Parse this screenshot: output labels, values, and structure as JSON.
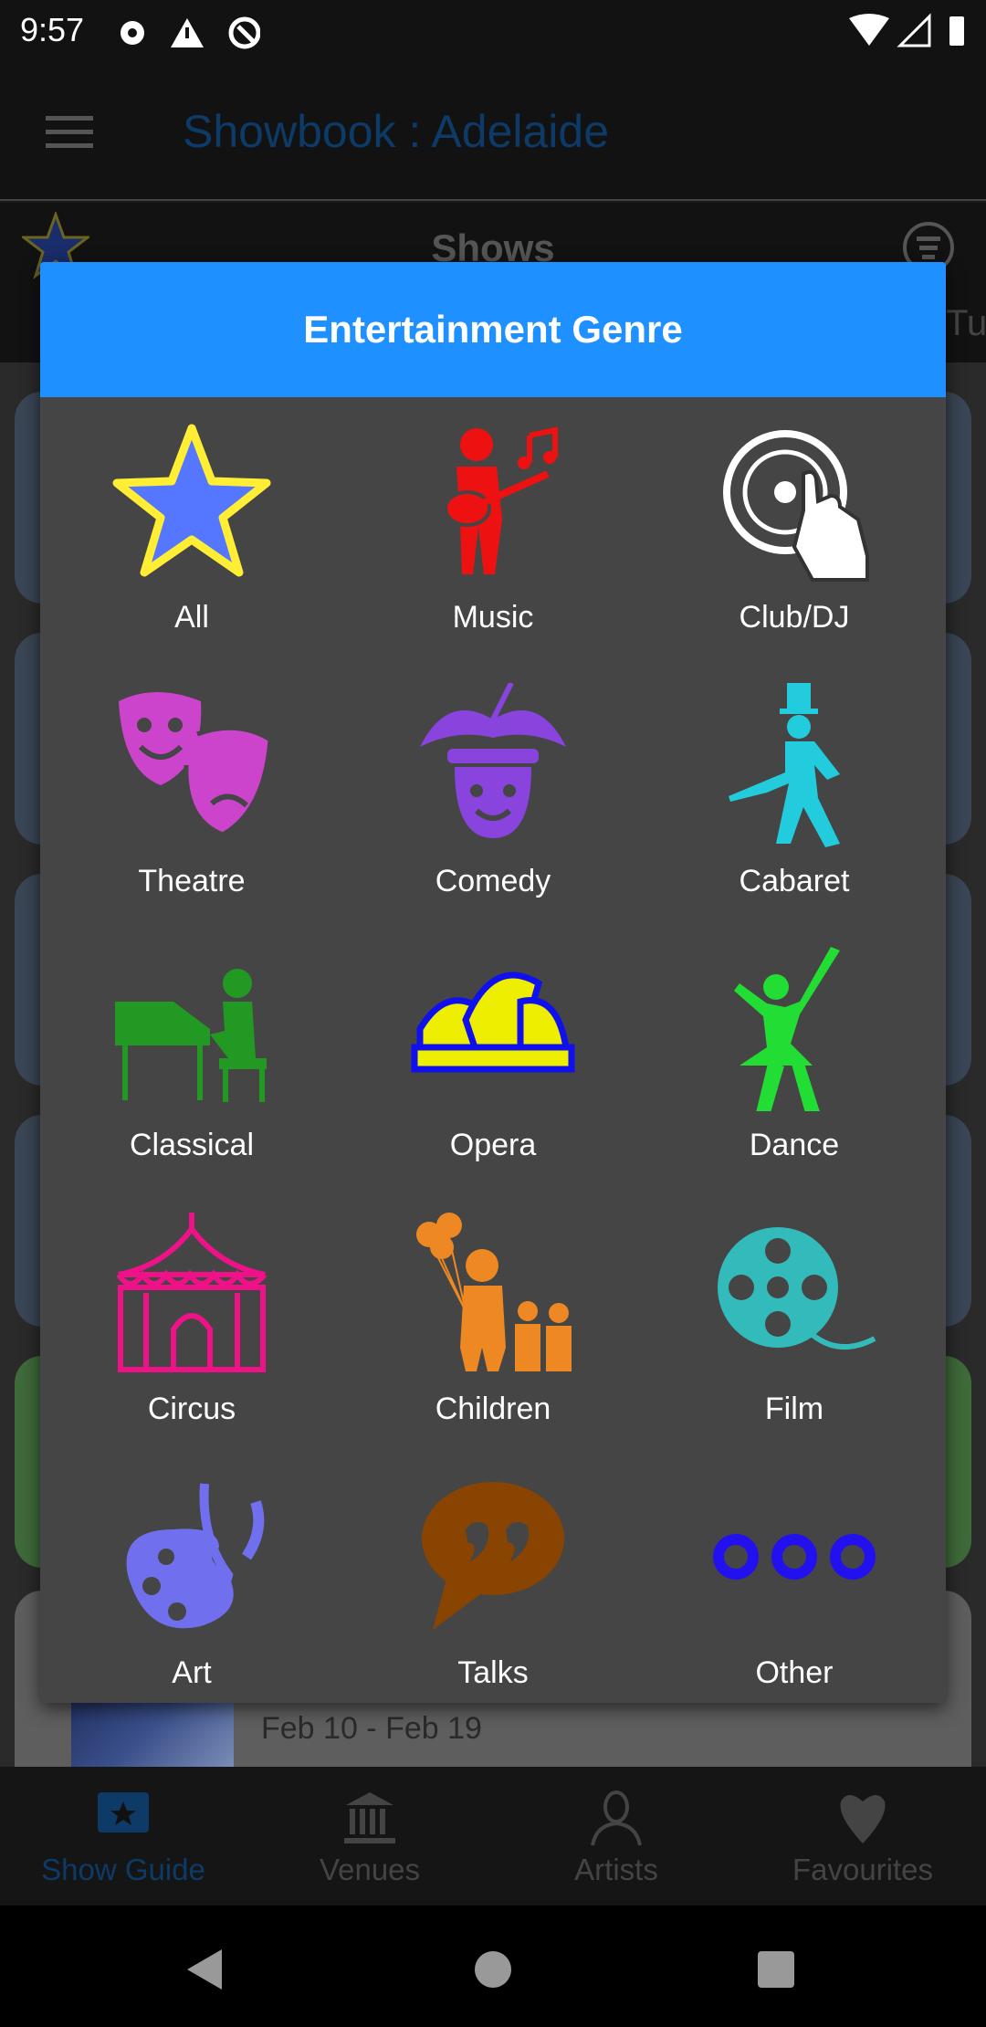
{
  "status_bar": {
    "time": "9:57",
    "icons": [
      "settings-icon",
      "warning-icon",
      "data-saver-icon",
      "wifi-icon",
      "signal-icon",
      "battery-icon"
    ]
  },
  "app_bar": {
    "title": "Showbook : Adelaide",
    "menu_icon": "hamburger-icon"
  },
  "shows_bar": {
    "title": "Shows",
    "partial_tab": "Tu"
  },
  "background_card": {
    "date": "Feb 10 - Feb 19"
  },
  "dialog": {
    "title": "Entertainment Genre",
    "header_color": "#1e90ff",
    "genres": [
      {
        "label": "All",
        "icon": "star-icon",
        "color": "#5577ff"
      },
      {
        "label": "Music",
        "icon": "guitarist-icon",
        "color": "#ee1111"
      },
      {
        "label": "Club/DJ",
        "icon": "dj-turntable-icon",
        "color": "#ffffff"
      },
      {
        "label": "Theatre",
        "icon": "theatre-masks-icon",
        "color": "#cc44cc"
      },
      {
        "label": "Comedy",
        "icon": "jester-icon",
        "color": "#8844dd"
      },
      {
        "label": "Cabaret",
        "icon": "top-hat-dancer-icon",
        "color": "#22ccdd"
      },
      {
        "label": "Classical",
        "icon": "pianist-icon",
        "color": "#229922"
      },
      {
        "label": "Opera",
        "icon": "opera-house-icon",
        "color": "#eeee00"
      },
      {
        "label": "Dance",
        "icon": "dancer-icon",
        "color": "#22dd33"
      },
      {
        "label": "Circus",
        "icon": "circus-tent-icon",
        "color": "#ee1188"
      },
      {
        "label": "Children",
        "icon": "family-balloons-icon",
        "color": "#ee8822"
      },
      {
        "label": "Film",
        "icon": "film-reel-icon",
        "color": "#33bbbb"
      },
      {
        "label": "Art",
        "icon": "palette-icon",
        "color": "#7070ee"
      },
      {
        "label": "Talks",
        "icon": "speech-bubble-icon",
        "color": "#884400"
      },
      {
        "label": "Other",
        "icon": "three-circles-icon",
        "color": "#2211ee"
      }
    ]
  },
  "bottom_nav": [
    {
      "label": "Show Guide",
      "icon": "ticket-star-icon",
      "active": true
    },
    {
      "label": "Venues",
      "icon": "building-icon"
    },
    {
      "label": "Artists",
      "icon": "person-icon"
    },
    {
      "label": "Favourites",
      "icon": "heart-icon"
    }
  ],
  "system_nav": [
    "back-icon",
    "home-icon",
    "recents-icon"
  ]
}
